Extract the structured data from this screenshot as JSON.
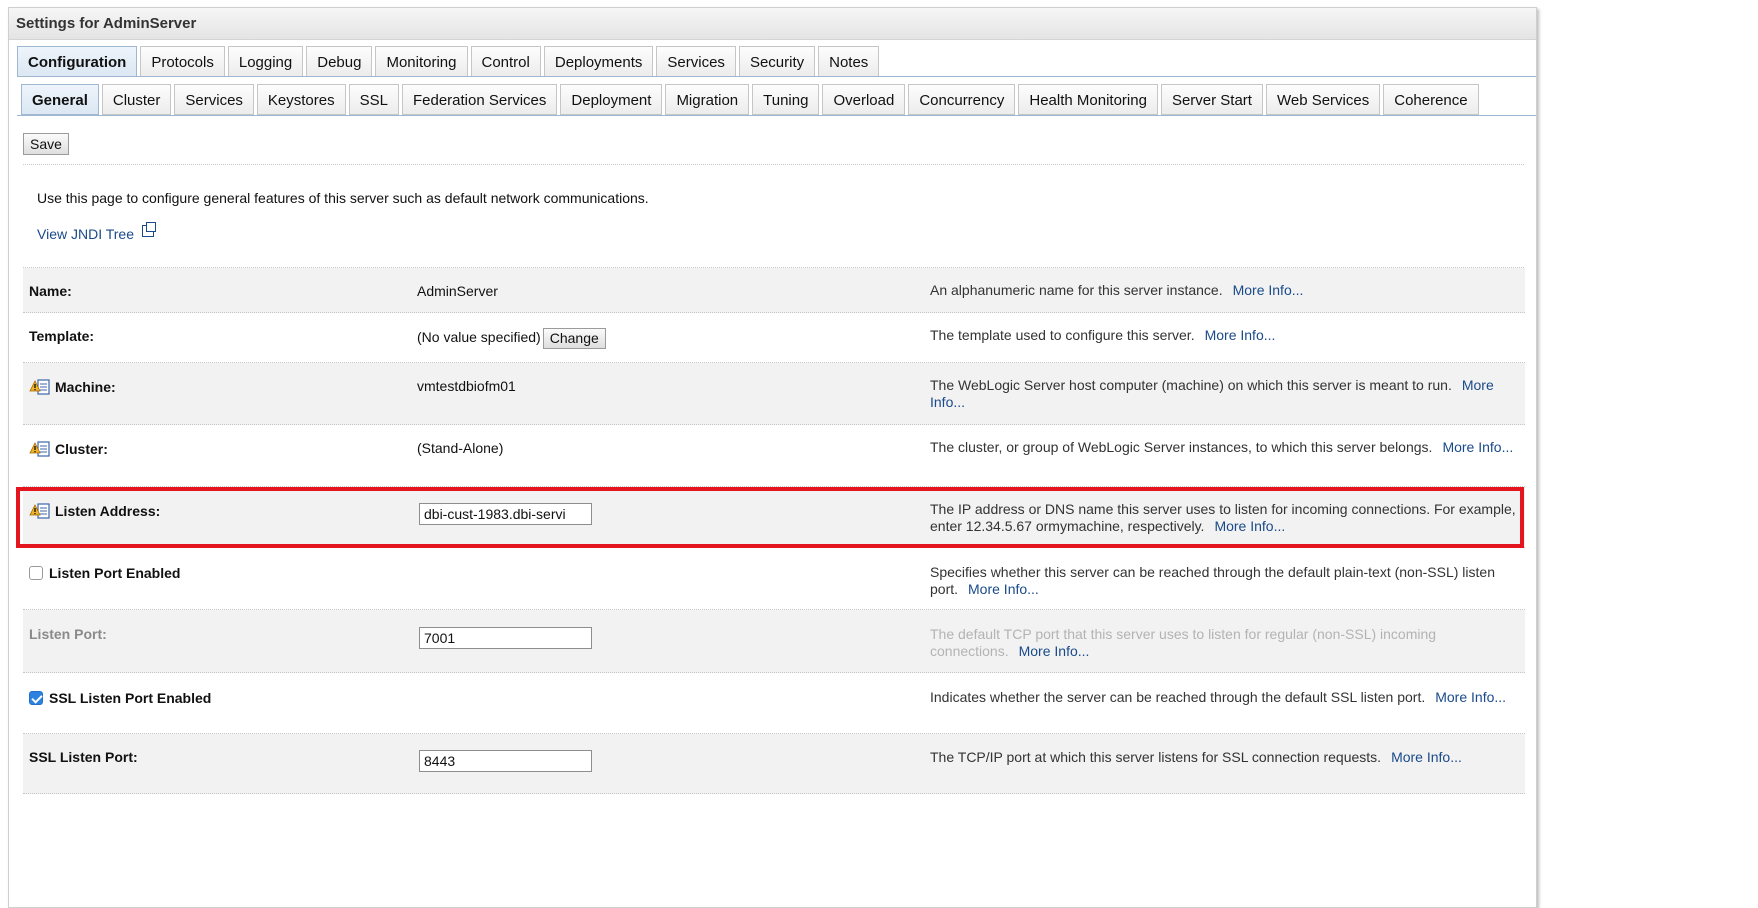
{
  "panel": {
    "title": "Settings for AdminServer"
  },
  "primary_tabs": [
    "Configuration",
    "Protocols",
    "Logging",
    "Debug",
    "Monitoring",
    "Control",
    "Deployments",
    "Services",
    "Security",
    "Notes"
  ],
  "secondary_tabs": [
    "General",
    "Cluster",
    "Services",
    "Keystores",
    "SSL",
    "Federation Services",
    "Deployment",
    "Migration",
    "Tuning",
    "Overload",
    "Concurrency",
    "Health Monitoring",
    "Server Start",
    "Web Services",
    "Coherence"
  ],
  "toolbar": {
    "save_label": "Save"
  },
  "intro": {
    "text": "Use this page to configure general features of this server such as default network communications.",
    "jndi_link": "View JNDI Tree"
  },
  "more_info": "More Info...",
  "rows": {
    "name": {
      "label": "Name:",
      "value": "AdminServer",
      "desc": "An alphanumeric name for this server instance."
    },
    "template": {
      "label": "Template:",
      "value": "(No value specified)",
      "button": "Change",
      "desc": "The template used to configure this server."
    },
    "machine": {
      "label": "Machine:",
      "value": "vmtestdbiofm01",
      "desc": "The WebLogic Server host computer (machine) on which this server is meant to run."
    },
    "cluster": {
      "label": "Cluster:",
      "value": "(Stand-Alone)",
      "desc": "The cluster, or group of WebLogic Server instances, to which this server belongs."
    },
    "listen_address": {
      "label": "Listen Address:",
      "value": "dbi-cust-1983.dbi-servi",
      "desc": "The IP address or DNS name this server uses to listen for incoming connections. For example, enter 12.34.5.67 ormymachine, respectively."
    },
    "listen_port_enabled": {
      "label": "Listen Port Enabled",
      "checked": false,
      "desc": "Specifies whether this server can be reached through the default plain-text (non-SSL) listen port."
    },
    "listen_port": {
      "label": "Listen Port:",
      "value": "7001",
      "desc": "The default TCP port that this server uses to listen for regular (non-SSL) incoming connections."
    },
    "ssl_listen_port_enabled": {
      "label": "SSL Listen Port Enabled",
      "checked": true,
      "desc": "Indicates whether the server can be reached through the default SSL listen port."
    },
    "ssl_listen_port": {
      "label": "SSL Listen Port:",
      "value": "8443",
      "desc": "The TCP/IP port at which this server listens for SSL connection requests."
    }
  },
  "colors": {
    "highlight": "#e4151e",
    "link": "#1a4a8a",
    "checkbox": "#2c82e0"
  }
}
